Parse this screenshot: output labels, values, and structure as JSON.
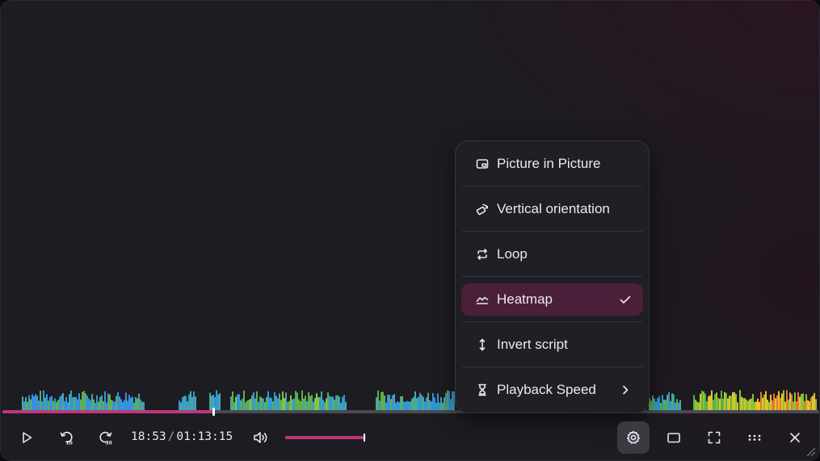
{
  "player": {
    "current_time": "18:53",
    "time_separator": "/",
    "duration": "01:13:15",
    "progress": 0.258,
    "volume": 0.98,
    "accent_color": "#c2357c"
  },
  "heatmap": {
    "colors": [
      "#3a8fe0",
      "#2f9ad6",
      "#4aa7a0",
      "#5fb04a",
      "#8bc23a",
      "#d2c52e",
      "#f0c21c",
      "#e07b3a",
      "#c54a8a"
    ]
  },
  "settings_menu": {
    "items": [
      {
        "label": "Picture in Picture",
        "icon": "picture-in-picture-icon",
        "checked": false,
        "submenu": false
      },
      {
        "label": "Vertical orientation",
        "icon": "rotate-icon",
        "checked": false,
        "submenu": false
      },
      {
        "label": "Loop",
        "icon": "loop-icon",
        "checked": false,
        "submenu": false
      },
      {
        "label": "Heatmap",
        "icon": "heatmap-icon",
        "checked": true,
        "submenu": false
      },
      {
        "label": "Invert script",
        "icon": "invert-arrows-icon",
        "checked": false,
        "submenu": false
      },
      {
        "label": "Playback Speed",
        "icon": "speed-icon",
        "checked": false,
        "submenu": true
      }
    ],
    "selected_bg": "#4a1f3a"
  },
  "controls": {
    "left": [
      "play-icon",
      "rewind-10-icon",
      "forward-30-icon",
      "volume-icon"
    ],
    "right": [
      "settings-gear-icon",
      "window-icon",
      "fullscreen-icon",
      "more-dots-icon",
      "close-icon"
    ]
  }
}
